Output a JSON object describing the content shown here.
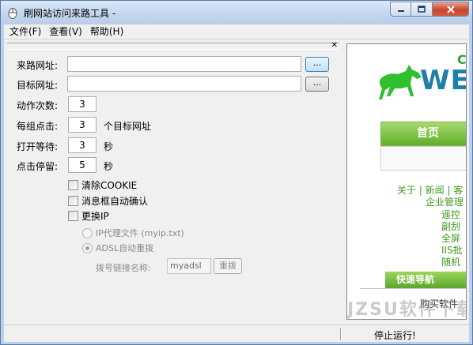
{
  "window": {
    "title": "刷网站访问来路工具 -"
  },
  "menu": {
    "items": [
      "文件(F)",
      "查看(V)",
      "帮助(H)"
    ]
  },
  "form": {
    "source_url_label": "来路网址:",
    "source_url_value": "",
    "target_url_label": "目标网址:",
    "target_url_value": "",
    "browse_label": "...",
    "action_count_label": "动作次数:",
    "action_count_value": "3",
    "group_click_label": "每组点击:",
    "group_click_value": "3",
    "group_click_unit": "个目标网址",
    "open_wait_label": "打开等待:",
    "open_wait_value": "3",
    "open_wait_unit": "秒",
    "click_stay_label": "点击停留:",
    "click_stay_value": "5",
    "click_stay_unit": "秒",
    "clear_cookie_label": "清除COOKIE",
    "auto_confirm_label": "消息框自动确认",
    "change_ip_label": "更换IP",
    "ip_proxy_label": "IP代理文件 (myip.txt)",
    "adsl_redial_label": "ADSL自动重拨",
    "dial_name_label": "拨号链接名称:",
    "dial_name_value": "myadsl",
    "redial_button": "重拨"
  },
  "browser": {
    "logo_text": "WE",
    "logo_c": "C",
    "home_tab": "首页",
    "links_line1": "关于 | 新闻 | 客",
    "links_line2": "企业管理",
    "links_line3": "遥控",
    "links_line4": "副刮",
    "links_line5": "全屏",
    "links_line6": "IIS批",
    "links_line7": "随机",
    "quick_nav": "快速导航",
    "buy_link": "购买软件",
    "watermark": "JZSU软件下载"
  },
  "status": {
    "text": "停止运行!"
  },
  "colors": {
    "accent_green": "#5fae2a",
    "logo_blue": "#1f7fa8"
  }
}
